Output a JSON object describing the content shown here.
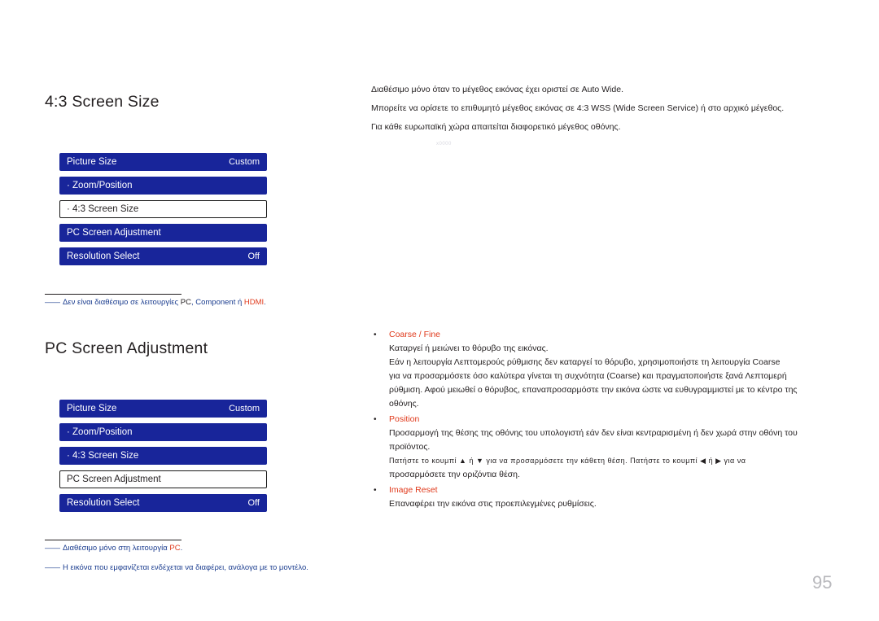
{
  "sections": {
    "first": {
      "title": "4:3 Screen Size",
      "osd": {
        "rows": [
          {
            "label": "Picture Size",
            "value": "Custom",
            "selected": false
          },
          {
            "label": "· Zoom/Position",
            "value": "",
            "selected": false
          },
          {
            "label": "· 4:3 Screen Size",
            "value": "",
            "selected": true
          },
          {
            "label": "PC Screen Adjustment",
            "value": "",
            "selected": false
          },
          {
            "label": "Resolution Select",
            "value": "Off",
            "selected": false
          }
        ]
      },
      "note": {
        "dash": "――",
        "text_before": "Δεν είναι διαθέσιμο σε λειτουργίες ",
        "pc": "PC",
        "middle": ", Component ή ",
        "hdmi": "HDMI",
        "tail": "."
      },
      "intro": [
        "Διαθέσιμο μόνο όταν το μέγεθος εικόνας έχει οριστεί σε Auto Wide.",
        "Μπορείτε να ορίσετε το επιθυμητό μέγεθος εικόνας σε 4:3 WSS (Wide Screen Service) ή στο αρχικό μέγεθος.",
        "Για κάθε ευρωπαϊκή χώρα απαιτείται διαφορετικό μέγεθος οθόνης."
      ],
      "watermark": "x0000"
    },
    "second": {
      "title": "PC Screen Adjustment",
      "osd": {
        "rows": [
          {
            "label": "Picture Size",
            "value": "Custom",
            "selected": false
          },
          {
            "label": "· Zoom/Position",
            "value": "",
            "selected": false
          },
          {
            "label": "· 4:3 Screen Size",
            "value": "",
            "selected": false
          },
          {
            "label": "PC Screen Adjustment",
            "value": "",
            "selected": true
          },
          {
            "label": "Resolution Select",
            "value": "Off",
            "selected": false
          }
        ]
      },
      "notes": [
        {
          "dash": "――",
          "text_before": "Διαθέσιμο μόνο στη λειτουργία ",
          "pc": "PC",
          "tail": "."
        },
        {
          "dash": "――",
          "text": "Η εικόνα που εμφανίζεται ενδέχεται να διαφέρει, ανάλογα με το μοντέλο."
        }
      ],
      "bullets": [
        {
          "dot": "•",
          "term": "Coarse / Fine",
          "lines": [
            "Καταργεί ή μειώνει το θόρυβο της εικόνας.",
            "Εάν η λειτουργία Λεπτομερούς ρύθμισης δεν καταργεί το θόρυβο, χρησιμοποιήστε τη λειτουργία Coarse",
            "για να προσαρμόσετε όσο καλύτερα γίνεται τη συχνότητα (Coarse) και πραγματοποιήστε ξανά Λεπτομερή",
            "ρύθμιση. Αφού μειωθεί ο θόρυβος, επαναπροσαρμόστε την εικόνα ώστε να ευθυγραμμιστεί με το κέντρο της",
            "οθόνης."
          ]
        },
        {
          "dot": "•",
          "term": "Position",
          "lines": [
            "Προσαρμογή της θέσης της οθόνης του υπολογιστή εάν δεν είναι κεντραρισμένη ή δεν χωρά στην οθόνη του",
            "προϊόντος.",
            "Πατήστε το κουμπί ▲ ή ▼ για να προσαρμόσετε την κάθετη θέση. Πατήστε το κουμπί ◀ ή ▶ για να",
            "προσαρμόσετε την οριζόντια θέση."
          ]
        },
        {
          "dot": "•",
          "term": "Image Reset",
          "lines": [
            "Επαναφέρει την εικόνα στις προεπιλεγμένες ρυθμίσεις."
          ]
        }
      ]
    }
  },
  "page_number": "95",
  "colors": {
    "osd_blue": "#18259a",
    "note_blue": "#1b3d8f",
    "accent_red": "#e03a1c",
    "page_number_gray": "#b9b9bd"
  }
}
